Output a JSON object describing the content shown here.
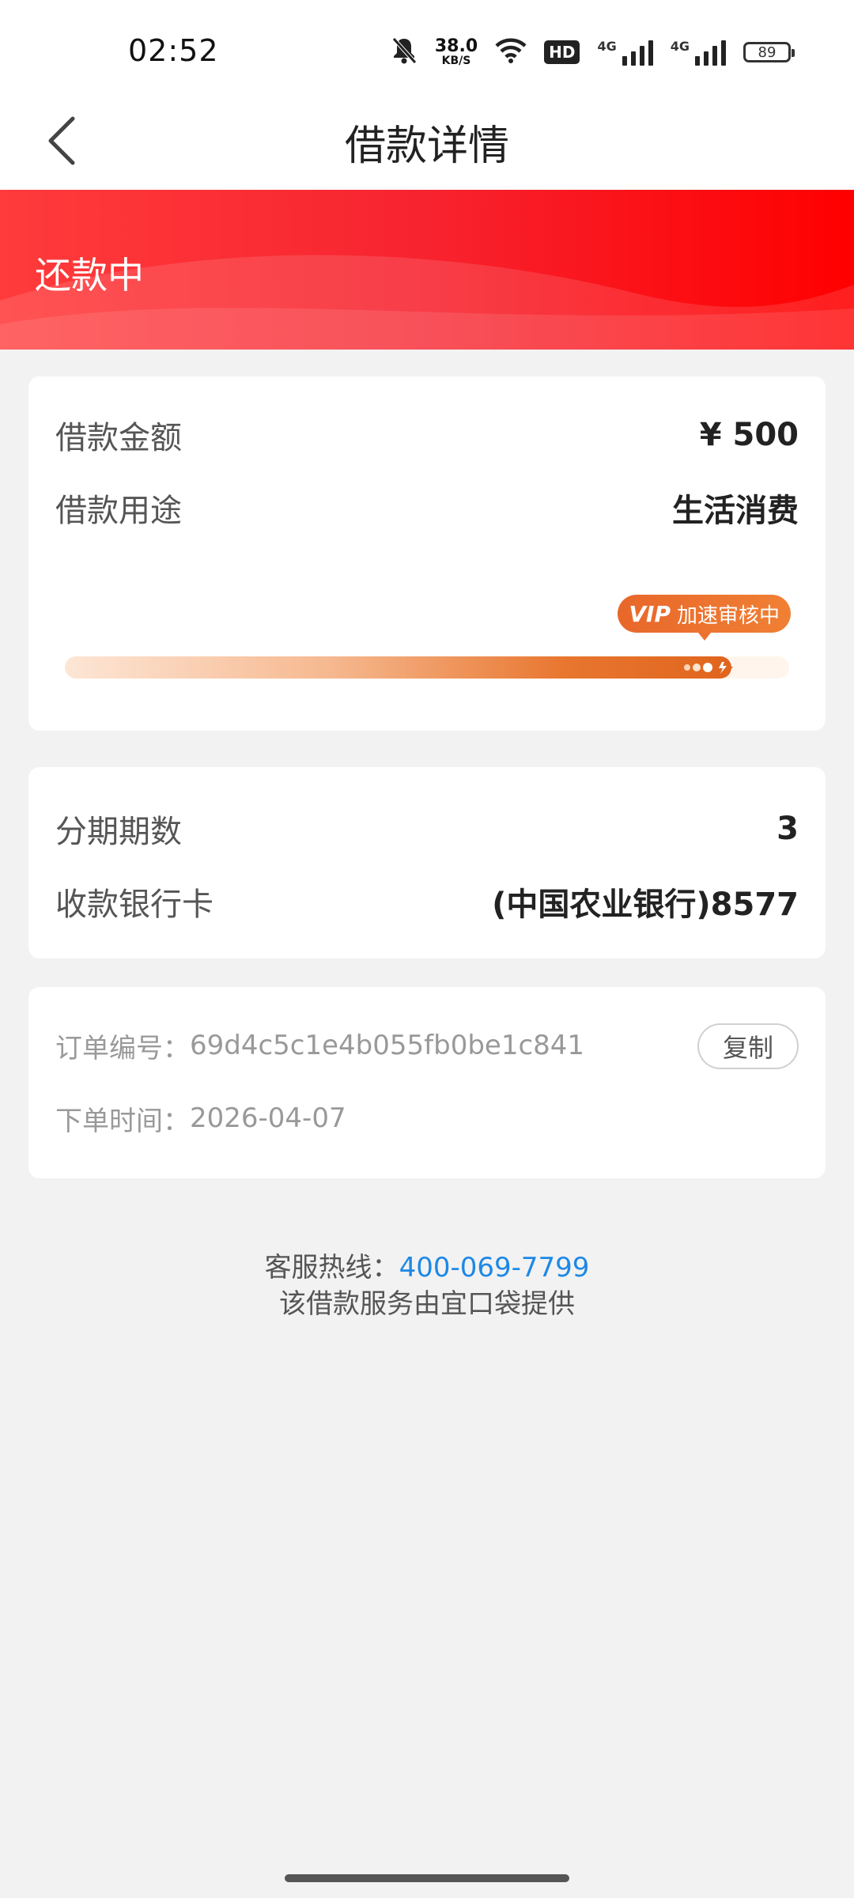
{
  "status_bar": {
    "time": "02:52",
    "net_speed_value": "38.0",
    "net_speed_unit": "KB/S",
    "hd_label": "HD",
    "signal_1_label": "4G",
    "signal_2_label": "4G",
    "battery": "89",
    "icons": [
      "bell-muted-icon",
      "wifi-icon",
      "hd-icon",
      "signal-icon",
      "signal-icon",
      "battery-icon"
    ]
  },
  "header": {
    "title": "借款详情",
    "back_icon": "chevron-left-icon"
  },
  "banner": {
    "status": "还款中",
    "color": "#f7232f"
  },
  "loan_card": {
    "amount_label": "借款金额",
    "amount_value": "¥ 500",
    "purpose_label": "借款用途",
    "purpose_value": "生活消费",
    "vip_tag": "VIP",
    "vip_text": "加速审核中",
    "progress_fraction": 0.92,
    "accent_color": "#e8672a"
  },
  "installment_card": {
    "periods_label": "分期期数",
    "periods_value": "3",
    "bank_label": "收款银行卡",
    "bank_value": "(中国农业银行)8577"
  },
  "order_card": {
    "order_no_label": "订单编号：",
    "order_no_value": "69d4c5c1e4b055fb0be1c841",
    "copy_button": "复制",
    "order_time_label": "下单时间：",
    "order_time_value": "2026-04-07"
  },
  "footer": {
    "hotline_label": "客服热线：",
    "hotline_number": "400-069-7799",
    "provider_text": "该借款服务由宜口袋提供",
    "link_color": "#1e88e5"
  }
}
